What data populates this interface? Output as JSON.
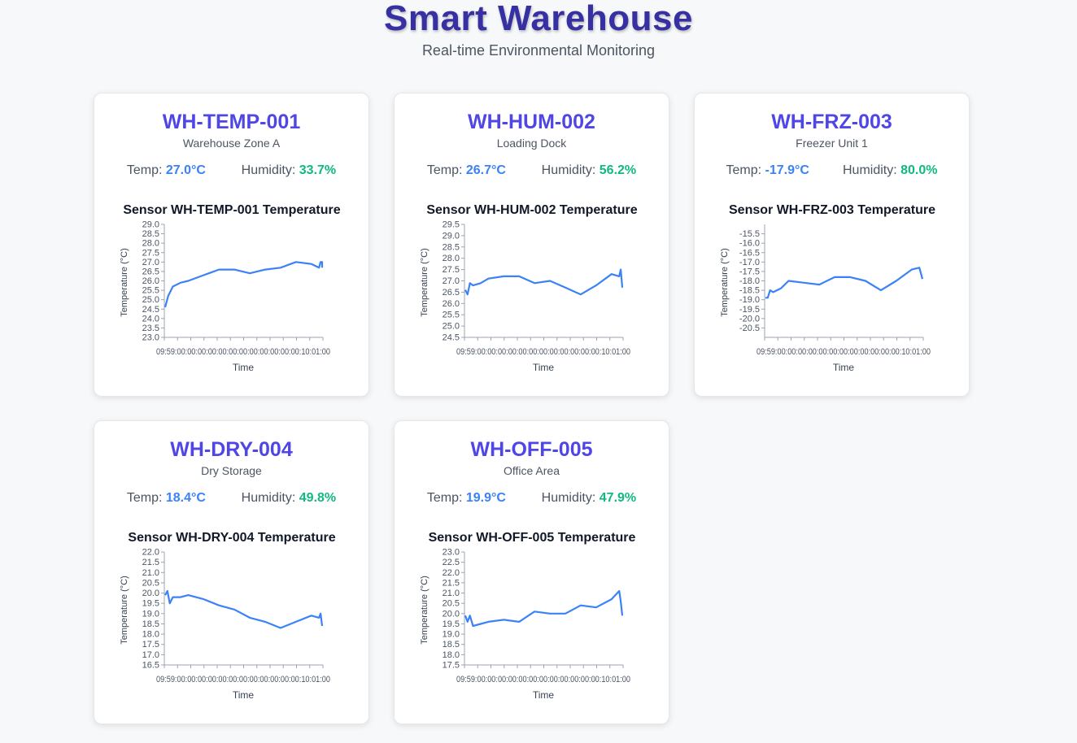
{
  "header": {
    "title": "Smart Warehouse",
    "subtitle": "Real-time Environmental Monitoring"
  },
  "labels": {
    "temp": "Temp: ",
    "humidity": "Humidity: "
  },
  "colors": {
    "title": "#3730a3",
    "sensor_id": "#4f46e5",
    "temp_value": "#3b82f6",
    "humidity_value": "#10b981",
    "line": "#3b82f6"
  },
  "sensors": [
    {
      "id": "WH-TEMP-001",
      "location": "Warehouse Zone A",
      "temp": "27.0°C",
      "humidity": "33.7%",
      "chart_title": "Sensor WH-TEMP-001 Temperature"
    },
    {
      "id": "WH-HUM-002",
      "location": "Loading Dock",
      "temp": "26.7°C",
      "humidity": "56.2%",
      "chart_title": "Sensor WH-HUM-002 Temperature"
    },
    {
      "id": "WH-FRZ-003",
      "location": "Freezer Unit 1",
      "temp": "-17.9°C",
      "humidity": "80.0%",
      "chart_title": "Sensor WH-FRZ-003 Temperature"
    },
    {
      "id": "WH-DRY-004",
      "location": "Dry Storage",
      "temp": "18.4°C",
      "humidity": "49.8%",
      "chart_title": "Sensor WH-DRY-004 Temperature"
    },
    {
      "id": "WH-OFF-005",
      "location": "Office Area",
      "temp": "19.9°C",
      "humidity": "47.9%",
      "chart_title": "Sensor WH-OFF-005 Temperature"
    }
  ],
  "chart_data": [
    {
      "type": "line",
      "title": "Sensor WH-TEMP-001 Temperature",
      "xlabel": "Time",
      "ylabel": "Temperature (°C)",
      "ylim": [
        23.0,
        29.0
      ],
      "yticks": [
        "29.0",
        "28.5",
        "28.0",
        "27.5",
        "27.0",
        "26.5",
        "26.0",
        "25.5",
        "25.0",
        "24.5",
        "24.0",
        "23.5",
        "23.0"
      ],
      "xtick_text": "09:59:00:00:00:00:00:00:00:00:00:00:00:00:10:01:00",
      "x": [
        0,
        0.4,
        1,
        2,
        3,
        5,
        7,
        9,
        11,
        13,
        15,
        17,
        19,
        20,
        20.2,
        20.4
      ],
      "values": [
        24.6,
        25.2,
        25.7,
        25.9,
        26.0,
        26.3,
        26.6,
        26.6,
        26.4,
        26.6,
        26.7,
        27.0,
        26.9,
        26.7,
        27.0,
        27.0,
        26.7
      ]
    },
    {
      "type": "line",
      "title": "Sensor WH-HUM-002 Temperature",
      "xlabel": "Time",
      "ylabel": "Temperature (°C)",
      "ylim": [
        24.5,
        29.5
      ],
      "yticks": [
        "29.5",
        "29.0",
        "28.5",
        "28.0",
        "27.5",
        "27.0",
        "26.5",
        "26.0",
        "25.5",
        "25.0",
        "24.5"
      ],
      "xtick_text": "09:59:00:00:00:00:00:00:00:00:00:00:00:00:10:01:00",
      "x": [
        0,
        0.3,
        0.6,
        1,
        2,
        3,
        5,
        7,
        9,
        11,
        13,
        15,
        17,
        19,
        20,
        20.2,
        20.4
      ],
      "values": [
        26.6,
        26.4,
        26.9,
        26.8,
        26.9,
        27.1,
        27.2,
        27.2,
        26.9,
        27.0,
        26.7,
        26.4,
        26.8,
        27.3,
        27.2,
        27.5,
        26.7
      ]
    },
    {
      "type": "line",
      "title": "Sensor WH-FRZ-003 Temperature",
      "xlabel": "Time",
      "ylabel": "Temperature (°C)",
      "ylim": [
        -21.0,
        -15.0
      ],
      "yticks": [
        "-15.5",
        "-16.0",
        "-16.5",
        "-17.0",
        "-17.5",
        "-18.0",
        "-18.5",
        "-19.0",
        "-19.5",
        "-20.0",
        "-20.5"
      ],
      "xtick_text": "09:59:00:00:00:00:00:00:00:00:00:00:00:00:10:01:00",
      "x": [
        0,
        0.3,
        0.6,
        1,
        2,
        3,
        5,
        7,
        9,
        11,
        13,
        15,
        17,
        19,
        20,
        20.2,
        20.4
      ],
      "values": [
        -18.9,
        -18.9,
        -18.5,
        -18.6,
        -18.4,
        -18.0,
        -18.1,
        -18.2,
        -17.8,
        -17.8,
        -18.0,
        -18.5,
        -18.0,
        -17.4,
        -17.3,
        -17.6,
        -17.9
      ]
    },
    {
      "type": "line",
      "title": "Sensor WH-DRY-004 Temperature",
      "xlabel": "Time",
      "ylabel": "Temperature (°C)",
      "ylim": [
        16.5,
        22.0
      ],
      "yticks": [
        "22.0",
        "21.5",
        "21.0",
        "20.5",
        "20.0",
        "19.5",
        "19.0",
        "18.5",
        "18.0",
        "17.5",
        "17.0",
        "16.5"
      ],
      "xtick_text": "09:59:00:00:00:00:00:00:00:00:00:00:00:00:10:01:00",
      "x": [
        0,
        0.3,
        0.6,
        1,
        2,
        3,
        5,
        7,
        9,
        11,
        13,
        15,
        17,
        19,
        20,
        20.2,
        20.4
      ],
      "values": [
        19.9,
        20.1,
        19.5,
        19.8,
        19.8,
        19.9,
        19.7,
        19.4,
        19.2,
        18.8,
        18.6,
        18.3,
        18.6,
        18.9,
        18.8,
        19.0,
        18.4
      ]
    },
    {
      "type": "line",
      "title": "Sensor WH-OFF-005 Temperature",
      "xlabel": "Time",
      "ylabel": "Temperature (°C)",
      "ylim": [
        17.5,
        23.0
      ],
      "yticks": [
        "23.0",
        "22.5",
        "22.0",
        "21.5",
        "21.0",
        "20.5",
        "20.0",
        "19.5",
        "19.0",
        "18.5",
        "18.0",
        "17.5"
      ],
      "xtick_text": "09:59:00:00:00:00:00:00:00:00:00:00:00:00:10:01:00",
      "x": [
        0,
        0.3,
        0.6,
        1,
        2,
        3,
        5,
        7,
        9,
        11,
        13,
        15,
        17,
        19,
        20,
        20.2,
        20.4
      ],
      "values": [
        19.9,
        19.6,
        19.9,
        19.4,
        19.5,
        19.6,
        19.7,
        19.6,
        20.1,
        20.0,
        20.0,
        20.4,
        20.3,
        20.7,
        21.1,
        20.6,
        19.9
      ]
    }
  ]
}
